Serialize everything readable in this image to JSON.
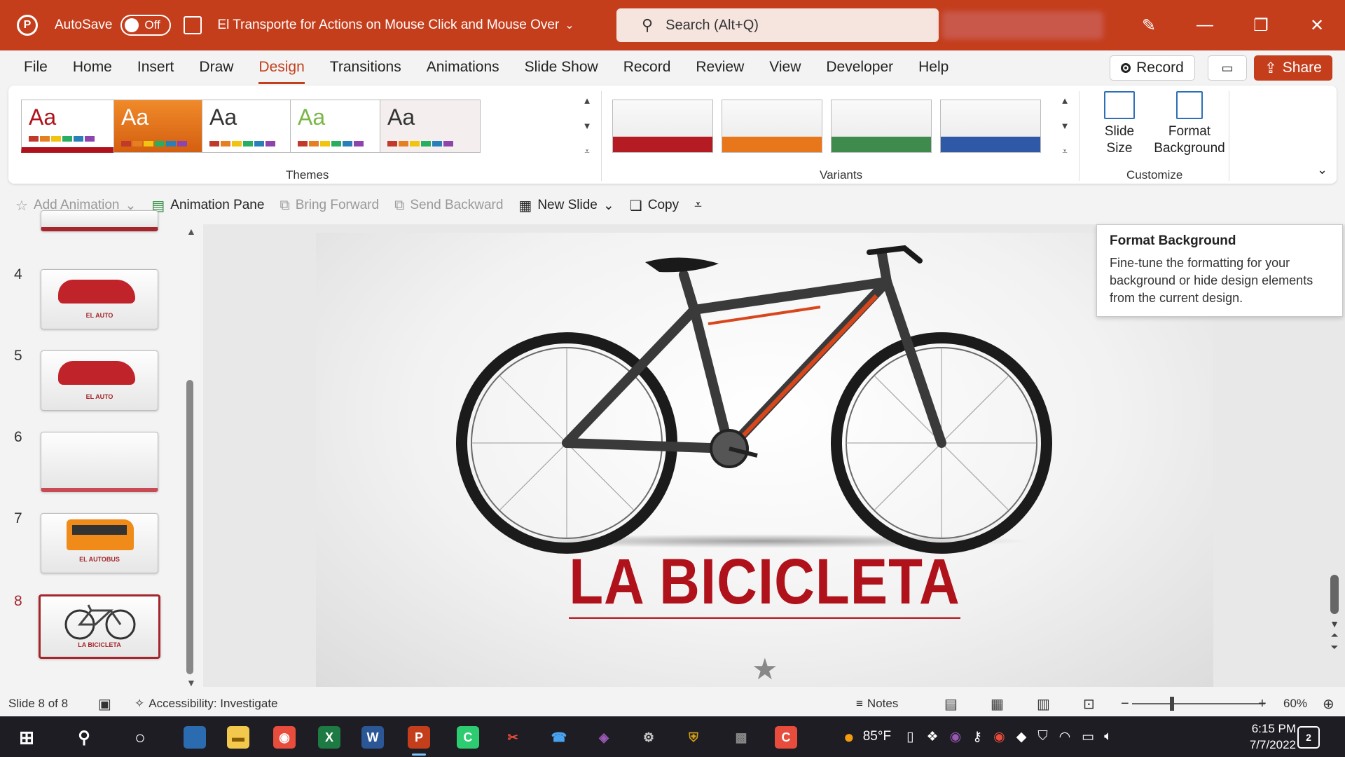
{
  "titlebar": {
    "autosave_label": "AutoSave",
    "autosave_state": "Off",
    "doc_title": "El Transporte for Actions on Mouse Click and Mouse Over",
    "search_placeholder": "Search (Alt+Q)"
  },
  "menu": {
    "items": [
      "File",
      "Home",
      "Insert",
      "Draw",
      "Design",
      "Transitions",
      "Animations",
      "Slide Show",
      "Record",
      "Review",
      "View",
      "Developer",
      "Help"
    ],
    "active": "Design",
    "record_label": "Record",
    "share_label": "Share"
  },
  "ribbon": {
    "themes_label": "Themes",
    "variants_label": "Variants",
    "customize_label": "Customize",
    "theme_glyph": "Aa",
    "slide_size_label_1": "Slide",
    "slide_size_label_2": "Size",
    "format_bg_label_1": "Format",
    "format_bg_label_2": "Background",
    "themes": [
      {
        "bg": "#ffffff",
        "accent": "#b0121b",
        "text": "#b0121b"
      },
      {
        "bg": "#e8761a",
        "accent": "#f39b3a",
        "text": "#ffffff"
      },
      {
        "bg": "#ffffff",
        "accent": "#ffffff",
        "text": "#333333"
      },
      {
        "bg": "#ffffff",
        "accent": "#7ab648",
        "text": "#7ab648"
      },
      {
        "bg": "#f4eeee",
        "accent": "#f4eeee",
        "text": "#333333"
      }
    ],
    "variants": [
      {
        "bg": "#b41b22"
      },
      {
        "bg": "#e8761a"
      },
      {
        "bg": "#3f8a4d"
      },
      {
        "bg": "#2f58a6"
      }
    ]
  },
  "qat": {
    "add_animation": "Add Animation",
    "animation_pane": "Animation Pane",
    "bring_forward": "Bring Forward",
    "send_backward": "Send Backward",
    "new_slide": "New Slide",
    "copy": "Copy"
  },
  "slides": {
    "numbers": [
      "4",
      "5",
      "6",
      "7",
      "8"
    ],
    "captions": [
      "EL AUTO",
      "EL AUTO",
      "",
      "EL AUTOBUS",
      "LA BICICLETA"
    ],
    "selected": "8"
  },
  "current_slide": {
    "title": "LA BICICLETA"
  },
  "tooltip": {
    "title": "Format Background",
    "body": "Fine-tune the formatting for your background or hide design elements from the current design."
  },
  "statusbar": {
    "slide_info": "Slide 8 of 8",
    "accessibility": "Accessibility: Investigate",
    "notes": "Notes",
    "zoom": "60%"
  },
  "taskbar": {
    "weather": "85°F",
    "time": "6:15 PM",
    "date": "7/7/2022",
    "notif_count": "2"
  }
}
